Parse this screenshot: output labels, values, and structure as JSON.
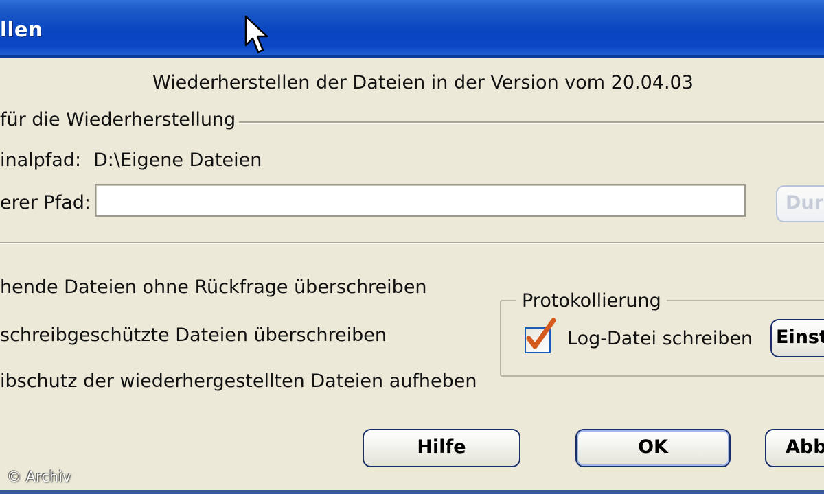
{
  "window": {
    "title": "llen"
  },
  "dialog": {
    "header": "Wiederherstellen der Dateien in der Version vom 20.04.03",
    "group_target": {
      "title": "für die Wiederherstellung",
      "original_label": "inalpfad:",
      "original_value": "D:\\Eigene Dateien",
      "other_label": "erer Pfad:",
      "other_value": "",
      "browse_label": "Dur"
    },
    "options": [
      "hende Dateien ohne Rückfrage überschreiben",
      "schreibgeschützte Dateien überschreiben",
      "ibschutz der wiederhergestellten Dateien aufheben"
    ],
    "logging": {
      "title": "Protokollierung",
      "checkbox_label": "Log-Datei schreiben",
      "checked": true,
      "settings_label": "Einst"
    },
    "buttons": {
      "help": "Hilfe",
      "ok": "OK",
      "cancel": "Abb"
    }
  },
  "watermark": "© Archiv",
  "colors": {
    "titlebar": "#0a46c0",
    "dialog_bg": "#ece9d8",
    "checkmark": "#d35a1c",
    "button_border": "#1a2f6a"
  }
}
